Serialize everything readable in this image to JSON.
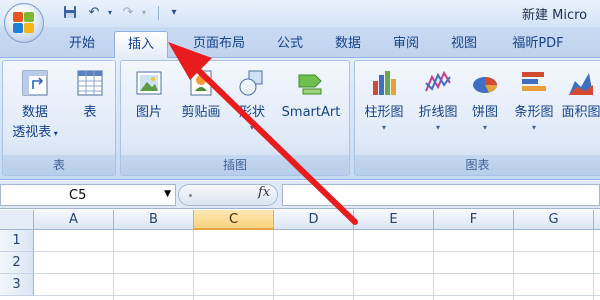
{
  "window": {
    "title": "新建 Micro"
  },
  "tabs": [
    {
      "label": "开始"
    },
    {
      "label": "插入"
    },
    {
      "label": "页面布局"
    },
    {
      "label": "公式"
    },
    {
      "label": "数据"
    },
    {
      "label": "审阅"
    },
    {
      "label": "视图"
    },
    {
      "label": "福昕PDF"
    }
  ],
  "ribbon": {
    "groups": [
      {
        "label": "表",
        "buttons": [
          {
            "label1": "数据",
            "label2": "透视表"
          },
          {
            "label1": "表"
          }
        ]
      },
      {
        "label": "插图",
        "buttons": [
          {
            "label1": "图片"
          },
          {
            "label1": "剪贴画"
          },
          {
            "label1": "形状"
          },
          {
            "label1": "SmartArt"
          }
        ]
      },
      {
        "label": "图表",
        "buttons": [
          {
            "label1": "柱形图"
          },
          {
            "label1": "折线图"
          },
          {
            "label1": "饼图"
          },
          {
            "label1": "条形图"
          },
          {
            "label1": "面积图"
          }
        ]
      }
    ]
  },
  "formula_bar": {
    "name_box": "C5",
    "fx_label": "fx",
    "value": ""
  },
  "sheet": {
    "columns": [
      "A",
      "B",
      "C",
      "D",
      "E",
      "F",
      "G"
    ],
    "selected_column": "C",
    "rows": [
      "1",
      "2",
      "3"
    ]
  },
  "icons": {
    "office_button": "office-logo-icon",
    "save": "save-icon",
    "undo": "undo-icon",
    "redo": "redo-icon",
    "customize": "customize-quick-access-icon"
  },
  "colors": {
    "accent": "#15428b",
    "arrow": "#e81c1c",
    "selected_header": "#f9d27f"
  }
}
